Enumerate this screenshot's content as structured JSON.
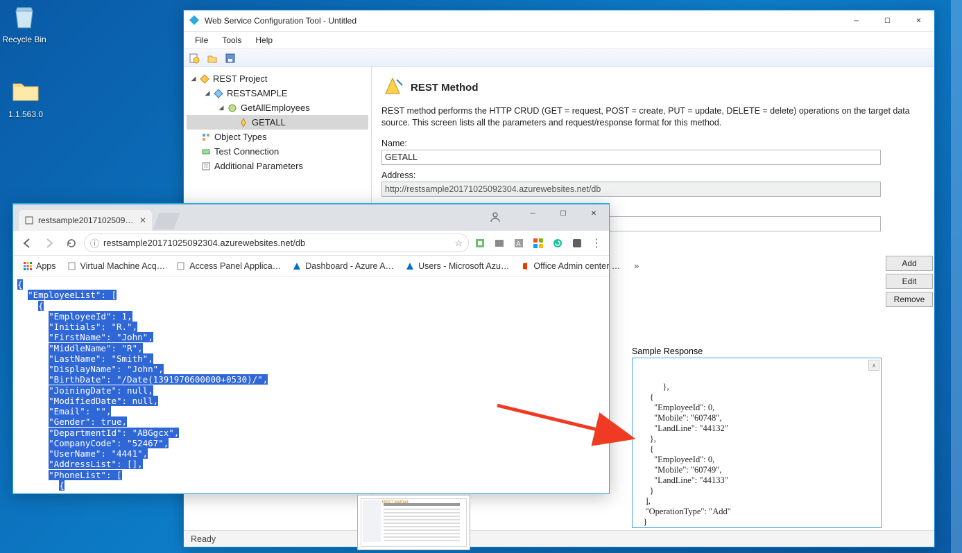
{
  "desktop": {
    "recycle_label": "Recycle Bin",
    "folder_label": "1.1.563.0"
  },
  "app": {
    "title": "Web Service Configuration Tool - Untitled",
    "menu": {
      "file": "File",
      "tools": "Tools",
      "help": "Help"
    },
    "tree": {
      "root": "REST Project",
      "sample": "RESTSAMPLE",
      "op": "GetAllEmployees",
      "method": "GETALL",
      "types": "Object Types",
      "test": "Test Connection",
      "params": "Additional Parameters"
    },
    "content": {
      "heading": "REST Method",
      "description": "REST method performs the HTTP CRUD (GET = request, POST = create, PUT = update, DELETE = delete) operations on the target data source. This screen lists all the parameters and request/response format for this method.",
      "name_label": "Name:",
      "name_value": "GETALL",
      "address_label": "Address:",
      "address_value": "http://restsample20171025092304.azurewebsites.net/db",
      "buttons": {
        "add": "Add",
        "edit": "Edit",
        "remove": "Remove"
      },
      "sample_label": "Sample Response",
      "sample_text": "      },\n      {\n        \"EmployeeId\": 0,\n        \"Mobile\": \"60748\",\n        \"LandLine\": \"44132\"\n      },\n      {\n        \"EmployeeId\": 0,\n        \"Mobile\": \"60749\",\n        \"LandLine\": \"44133\"\n      }\n    ],\n    \"OperationType\": \"Add\"\n   }\n  ]\n}]"
    },
    "status": "Ready"
  },
  "browser": {
    "tab_title": "restsample2017102509…",
    "url": "restsample20171025092304.azurewebsites.net/db",
    "bookmarks": {
      "apps": "Apps",
      "vm": "Virtual Machine Acq…",
      "access": "Access Panel Applica…",
      "azure": "Dashboard - Azure A…",
      "users": "Users - Microsoft Azu…",
      "office": "Office Admin center …"
    },
    "json_lines": [
      "{",
      "  \"EmployeeList\": [",
      "    {",
      "      \"EmployeeId\": 1,",
      "      \"Initials\": \"R.\",",
      "      \"FirstName\": \"John\",",
      "      \"MiddleName\": \"R\",",
      "      \"LastName\": \"Smith\",",
      "      \"DisplayName\": \"John\",",
      "      \"BirthDate\": \"/Date(1391970600000+0530)/\",",
      "      \"JoiningDate\": null,",
      "      \"ModifiedDate\": null,",
      "      \"Email\": \"\",",
      "      \"Gender\": true,",
      "      \"DepartmentId\": \"ABGgcx\",",
      "      \"CompanyCode\": \"52467\",",
      "      \"UserName\": \"4441\",",
      "      \"AddressList\": [],",
      "      \"PhoneList\": [",
      "        {"
    ]
  }
}
